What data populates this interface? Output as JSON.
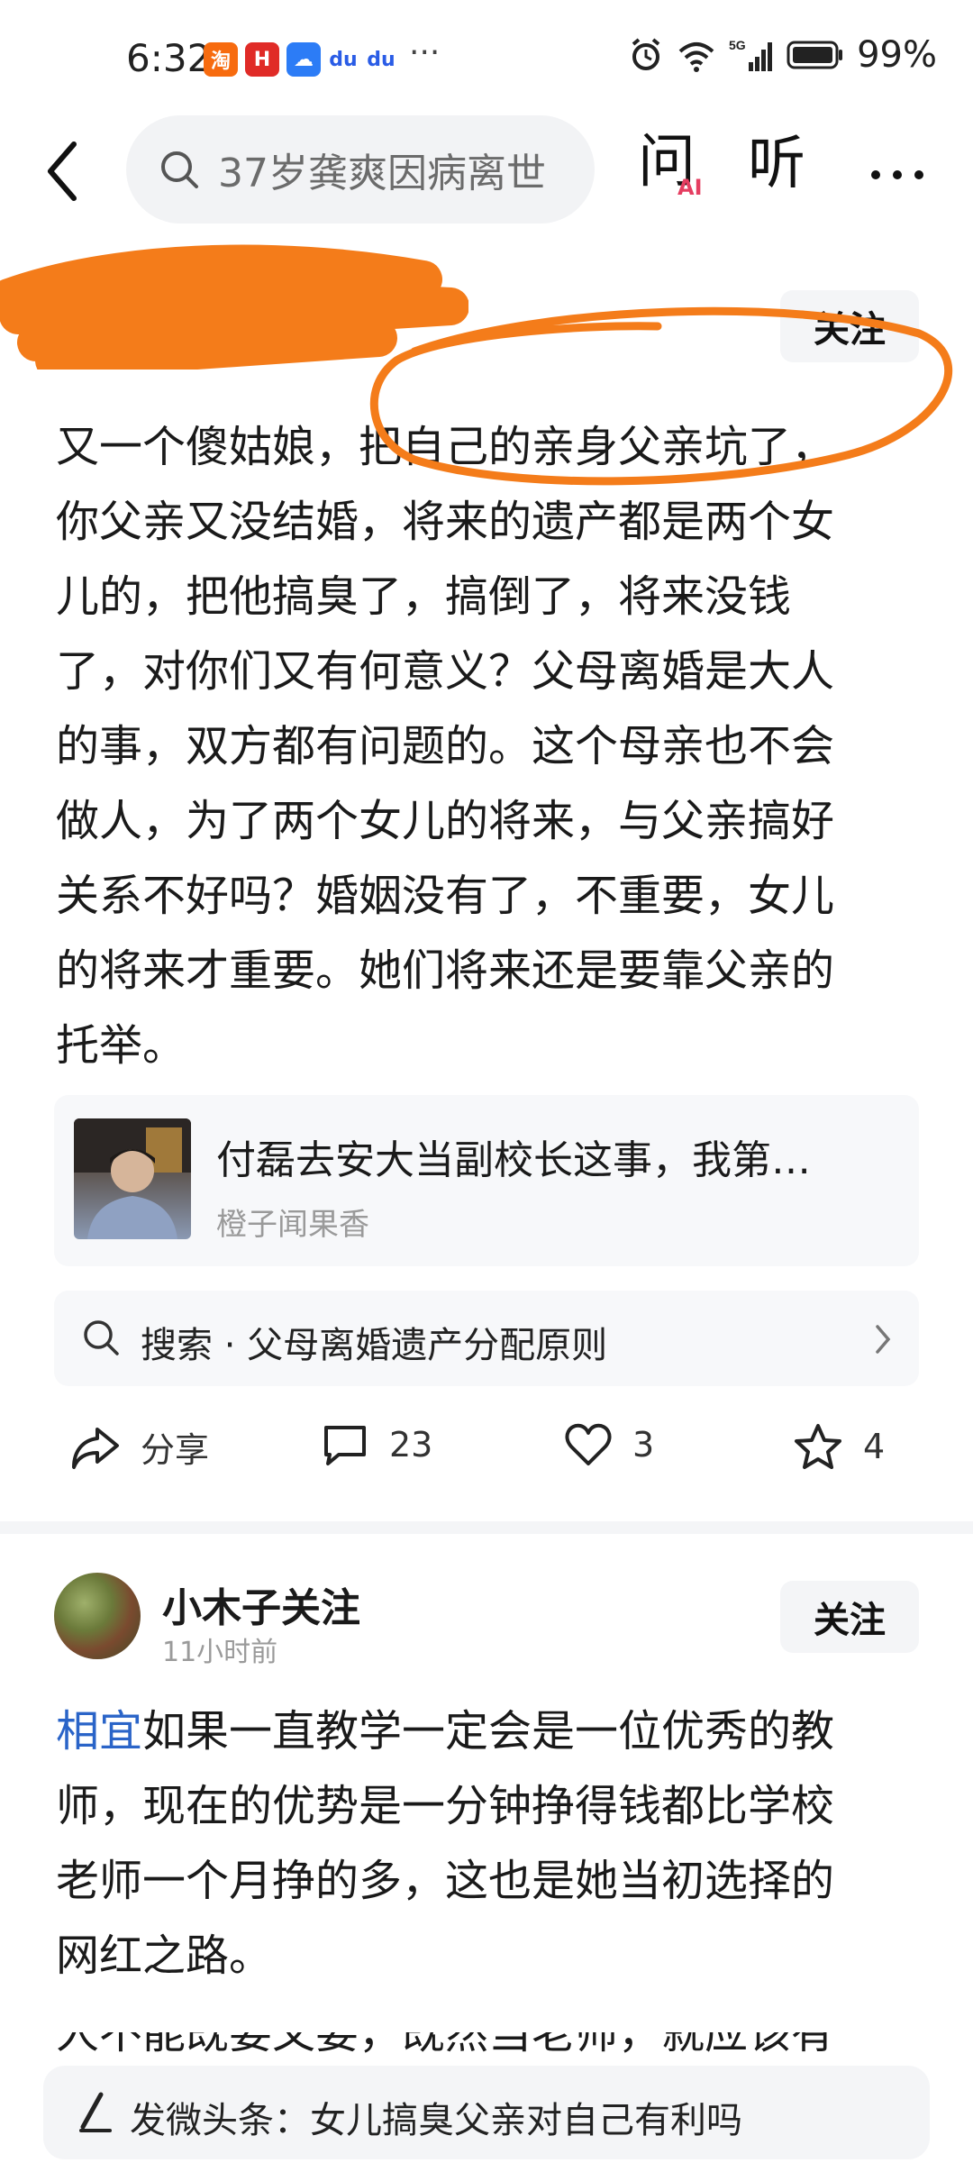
{
  "status_bar": {
    "time": "6:32",
    "app_icons": [
      {
        "name": "taobao-icon",
        "glyph": "淘",
        "color": "#f76b0f"
      },
      {
        "name": "huawei-icon",
        "glyph": "H",
        "color": "#e02b27"
      },
      {
        "name": "cloud-icon",
        "glyph": "☁",
        "color": "#2c7cf6"
      },
      {
        "name": "baidu-icon",
        "glyph": "du",
        "color": "#2a5ce6"
      },
      {
        "name": "baidu-icon",
        "glyph": "du",
        "color": "#2a5ce6"
      }
    ],
    "more": "···",
    "battery": "99%"
  },
  "top_bar": {
    "search_text": "37岁龚爽因病离世",
    "ask_label": "问",
    "ai_badge": "AI",
    "listen_label": "听"
  },
  "post1": {
    "follow_label": "关注",
    "text_lines": [
      "又一个傻姑娘，把自己的亲身父亲坑了，",
      "你父亲又没结婚，将来的遗产都是两个女",
      "儿的，把他搞臭了，搞倒了，将来没钱",
      "了，对你们又有何意义？父母离婚是大人",
      "的事，双方都有问题的。这个母亲也不会",
      "做人，为了两个女儿的将来，与父亲搞好",
      "关系不好吗？婚姻没有了，不重要，女儿",
      "的将来才重要。她们将来还是要靠父亲的",
      "托举。"
    ],
    "link_card": {
      "title": "付磊去安大当副校长这事，我第…",
      "author": "橙子闻果香"
    },
    "search_suggestion": "搜索 · 父母离婚遗产分配原则",
    "actions": {
      "share": "分享",
      "comments": "23",
      "likes": "3",
      "favorites": "4"
    }
  },
  "post2": {
    "author": "小木子关注",
    "time": "11小时前",
    "follow_label": "关注",
    "topic": "相宜",
    "first_line_rest": "如果一直教学一定会是一位优秀的教",
    "text_lines": [
      "师，现在的优势是一分钟挣得钱都比学校",
      "老师一个月挣的多，这也是她当初选择的",
      "网红之路。"
    ],
    "cut_line": "人不能既要又要，既然当老师，就应该有"
  },
  "bottom_bar": {
    "text": "发微头条：女儿搞臭父亲对自己有利吗"
  },
  "colors": {
    "accent_blue": "#2a64c8",
    "annotation_orange": "#f47c1a"
  }
}
